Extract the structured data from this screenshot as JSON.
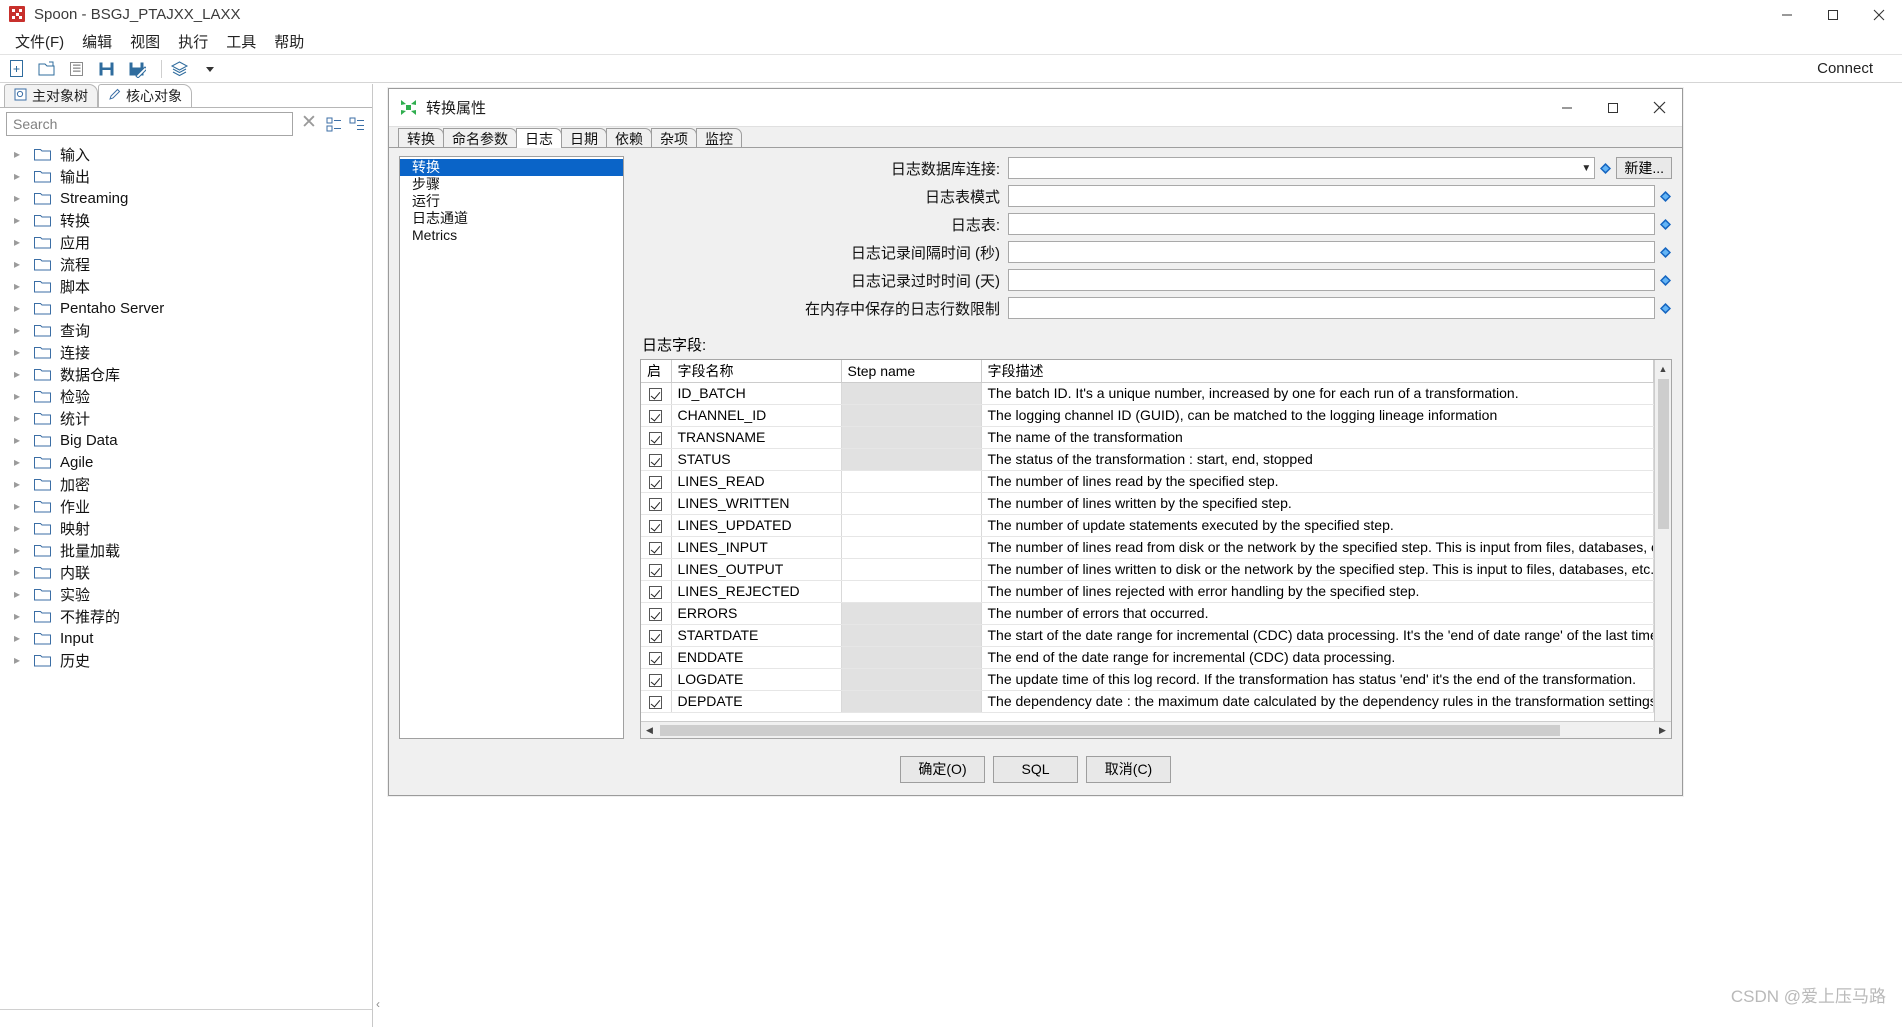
{
  "window": {
    "title": "Spoon - BSGJ_PTAJXX_LAXX",
    "minimize": "─",
    "maximize": "□",
    "close": "✕"
  },
  "menubar": {
    "items": [
      "文件(F)",
      "编辑",
      "视图",
      "执行",
      "工具",
      "帮助"
    ]
  },
  "toolbar": {
    "icons": [
      "new-file-icon",
      "open-file-icon",
      "explorer-icon",
      "save-icon",
      "save-as-icon",
      "layers-icon",
      "dropdown-arrow-icon"
    ],
    "connect_label": "Connect"
  },
  "explorer": {
    "tabs": [
      {
        "label": "主对象树",
        "icon": "tree-view-icon",
        "active": false
      },
      {
        "label": "核心对象",
        "icon": "pencil-icon",
        "active": true
      }
    ],
    "search": {
      "placeholder": "Search",
      "value": ""
    },
    "clear_label": "✕",
    "toolbar_icons": [
      "expand-all-icon",
      "collapse-all-icon"
    ],
    "tree": [
      "输入",
      "输出",
      "Streaming",
      "转换",
      "应用",
      "流程",
      "脚本",
      "Pentaho Server",
      "查询",
      "连接",
      "数据仓库",
      "检验",
      "统计",
      "Big Data",
      "Agile",
      "加密",
      "作业",
      "映射",
      "批量加载",
      "内联",
      "实验",
      "不推荐的",
      "Input",
      "历史"
    ]
  },
  "canvas": {
    "watermark": "CSDN @爱上压马路",
    "scroll_left": "‹"
  },
  "dialog": {
    "title": "转换属性",
    "icon": "kettle-icon",
    "minimize": "─",
    "maximize": "□",
    "close": "✕",
    "tabs": [
      {
        "label": "转换",
        "active": false
      },
      {
        "label": "命名参数",
        "active": false
      },
      {
        "label": "日志",
        "active": true
      },
      {
        "label": "日期",
        "active": false
      },
      {
        "label": "依赖",
        "active": false
      },
      {
        "label": "杂项",
        "active": false
      },
      {
        "label": "监控",
        "active": false
      }
    ],
    "side_list": [
      {
        "label": "转换",
        "selected": true
      },
      {
        "label": "步骤",
        "selected": false
      },
      {
        "label": "运行",
        "selected": false
      },
      {
        "label": "日志通道",
        "selected": false
      },
      {
        "label": "Metrics",
        "selected": false
      }
    ],
    "form": [
      {
        "label": "日志数据库连接:",
        "value": "",
        "type": "combo",
        "has_variable_icon": true,
        "button": "新建..."
      },
      {
        "label": "日志表模式",
        "value": "",
        "type": "text",
        "has_variable_icon": true,
        "button": ""
      },
      {
        "label": "日志表:",
        "value": "",
        "type": "text",
        "has_variable_icon": true,
        "button": ""
      },
      {
        "label": "日志记录间隔时间 (秒)",
        "value": "",
        "type": "text",
        "has_variable_icon": true,
        "button": ""
      },
      {
        "label": "日志记录过时时间 (天)",
        "value": "",
        "type": "text",
        "has_variable_icon": true,
        "button": ""
      },
      {
        "label": "在内存中保存的日志行数限制",
        "value": "",
        "type": "text",
        "has_variable_icon": true,
        "button": ""
      }
    ],
    "fields_caption": "日志字段:",
    "table": {
      "columns": [
        "启",
        "字段名称",
        "Step name",
        "字段描述"
      ],
      "rows": [
        {
          "enabled": true,
          "field": "ID_BATCH",
          "step": "",
          "step_shaded": true,
          "desc": "The batch ID. It's a unique number, increased by one for each run of a transformation."
        },
        {
          "enabled": true,
          "field": "CHANNEL_ID",
          "step": "",
          "step_shaded": true,
          "desc": "The logging channel ID (GUID), can be matched to the logging lineage information"
        },
        {
          "enabled": true,
          "field": "TRANSNAME",
          "step": "",
          "step_shaded": true,
          "desc": "The name of the transformation"
        },
        {
          "enabled": true,
          "field": "STATUS",
          "step": "",
          "step_shaded": true,
          "desc": "The status of the transformation : start, end, stopped"
        },
        {
          "enabled": true,
          "field": "LINES_READ",
          "step": "",
          "step_shaded": false,
          "desc": "The number of lines read by the specified step."
        },
        {
          "enabled": true,
          "field": "LINES_WRITTEN",
          "step": "",
          "step_shaded": false,
          "desc": "The number of lines written by the specified step."
        },
        {
          "enabled": true,
          "field": "LINES_UPDATED",
          "step": "",
          "step_shaded": false,
          "desc": "The number of update statements executed by the specified step."
        },
        {
          "enabled": true,
          "field": "LINES_INPUT",
          "step": "",
          "step_shaded": false,
          "desc": "The number of lines read from disk or the network by the specified step. This is input from files, databases, etc."
        },
        {
          "enabled": true,
          "field": "LINES_OUTPUT",
          "step": "",
          "step_shaded": false,
          "desc": "The number of lines written to disk or the network by the specified step. This is input to files, databases, etc."
        },
        {
          "enabled": true,
          "field": "LINES_REJECTED",
          "step": "",
          "step_shaded": false,
          "desc": "The number of lines rejected with error handling by the specified step."
        },
        {
          "enabled": true,
          "field": "ERRORS",
          "step": "",
          "step_shaded": true,
          "desc": "The number of errors that occurred."
        },
        {
          "enabled": true,
          "field": "STARTDATE",
          "step": "",
          "step_shaded": true,
          "desc": "The start of the date range for incremental (CDC) data processing. It's the 'end of date range' of the last time this transf"
        },
        {
          "enabled": true,
          "field": "ENDDATE",
          "step": "",
          "step_shaded": true,
          "desc": "The end of the date range for incremental (CDC) data processing."
        },
        {
          "enabled": true,
          "field": "LOGDATE",
          "step": "",
          "step_shaded": true,
          "desc": "The update time of this log record.  If the transformation has status 'end' it's the end of the transformation."
        },
        {
          "enabled": true,
          "field": "DEPDATE",
          "step": "",
          "step_shaded": true,
          "desc": "The dependency date : the maximum date calculated by the dependency rules in the transformation settings."
        }
      ]
    },
    "footer_buttons": [
      "确定(O)",
      "SQL",
      "取消(C)"
    ]
  }
}
